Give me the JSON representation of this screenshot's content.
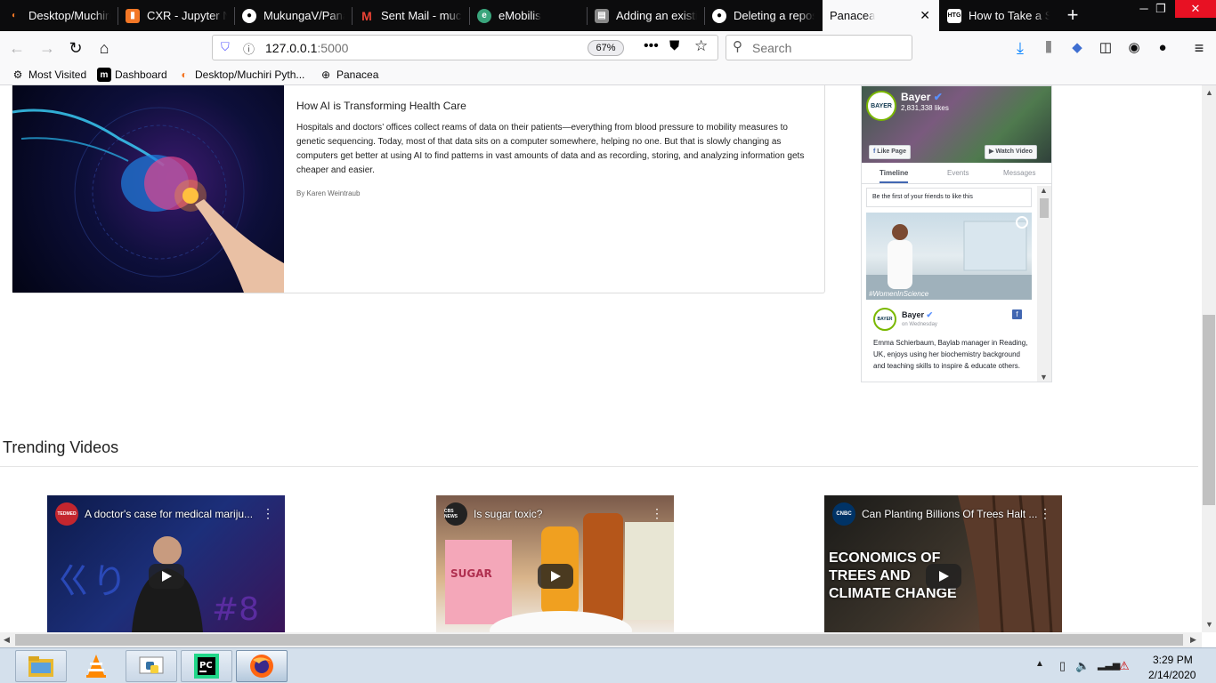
{
  "browser": {
    "tabs": [
      {
        "title": "Desktop/Muchiri",
        "icon": "jupyter-icon",
        "color": "#f37726"
      },
      {
        "title": "CXR - Jupyter Nc",
        "icon": "notebook-icon",
        "color": "#f37726"
      },
      {
        "title": "MukungaV/Pana",
        "icon": "github-icon",
        "color": "#ffffff"
      },
      {
        "title": "Sent Mail - much",
        "icon": "gmail-icon",
        "color": "#ea4335"
      },
      {
        "title": "eMobilis",
        "icon": "emobilis-icon",
        "color": "#3aa57c"
      },
      {
        "title": "Adding an existi",
        "icon": "stackoverflow-icon",
        "color": "#888888"
      },
      {
        "title": "Deleting a reposi",
        "icon": "github-icon",
        "color": "#ffffff"
      },
      {
        "title": "Panacea",
        "icon": "",
        "color": ""
      },
      {
        "title": "How to Take a Sc",
        "icon": "htg-icon",
        "color": "#ffffff"
      }
    ],
    "active_tab_index": 7,
    "url": {
      "host": "127.0.0.1",
      "port": ":5000"
    },
    "zoom": "67%",
    "search_placeholder": "Search",
    "bookmarks": [
      {
        "label": "Most Visited",
        "icon": "gear-icon"
      },
      {
        "label": "Dashboard",
        "icon": "dashboard-icon"
      },
      {
        "label": "Desktop/Muchiri Pyth...",
        "icon": "jupyter-icon"
      },
      {
        "label": "Panacea",
        "icon": "globe-icon"
      }
    ]
  },
  "article": {
    "title": "How AI is Transforming Health Care",
    "body": "Hospitals and doctors’ offices collect reams of data on their patients—everything from blood pressure to mobility measures to genetic sequencing. Today, most of that data sits on a computer somewhere, helping no one. But that is slowly changing as computers get better at using AI to find patterns in vast amounts of data and as recording, storing, and analyzing information gets cheaper and easier.",
    "author": "By Karen Weintraub"
  },
  "facebook": {
    "page_name": "Bayer",
    "logo_text": "BAYER",
    "likes": "2,831,338 likes",
    "like_button": "Like Page",
    "watch_button": "Watch Video",
    "tabs": [
      "Timeline",
      "Events",
      "Messages"
    ],
    "friends_text": "Be the first of your friends to like this",
    "post": {
      "tag": "#WomenInScience",
      "author": "Bayer",
      "time": "on Wednesday",
      "text": "Emma Schierbaum, Baylab manager in Reading, UK, enjoys using her biochemistry background and teaching skills to inspire & educate others."
    }
  },
  "trending": {
    "heading": "Trending Videos",
    "videos": [
      {
        "title": "A doctor's case for medical mariju...",
        "channel": "TEDMED",
        "channel_color": "#c4262e"
      },
      {
        "title": "Is sugar toxic?",
        "channel": "CBS NEWS",
        "channel_color": "#222222"
      },
      {
        "title": "Can Planting Billions Of Trees Halt ...",
        "channel": "CNBC",
        "channel_color": "#003366",
        "overlay": "ECONOMICS OF TREES AND CLIMATE CHANGE"
      }
    ]
  },
  "taskbar": {
    "apps": [
      "file-explorer-icon",
      "vlc-icon",
      "python-icon",
      "pycharm-icon",
      "firefox-icon"
    ],
    "time": "3:29 PM",
    "date": "2/14/2020"
  }
}
